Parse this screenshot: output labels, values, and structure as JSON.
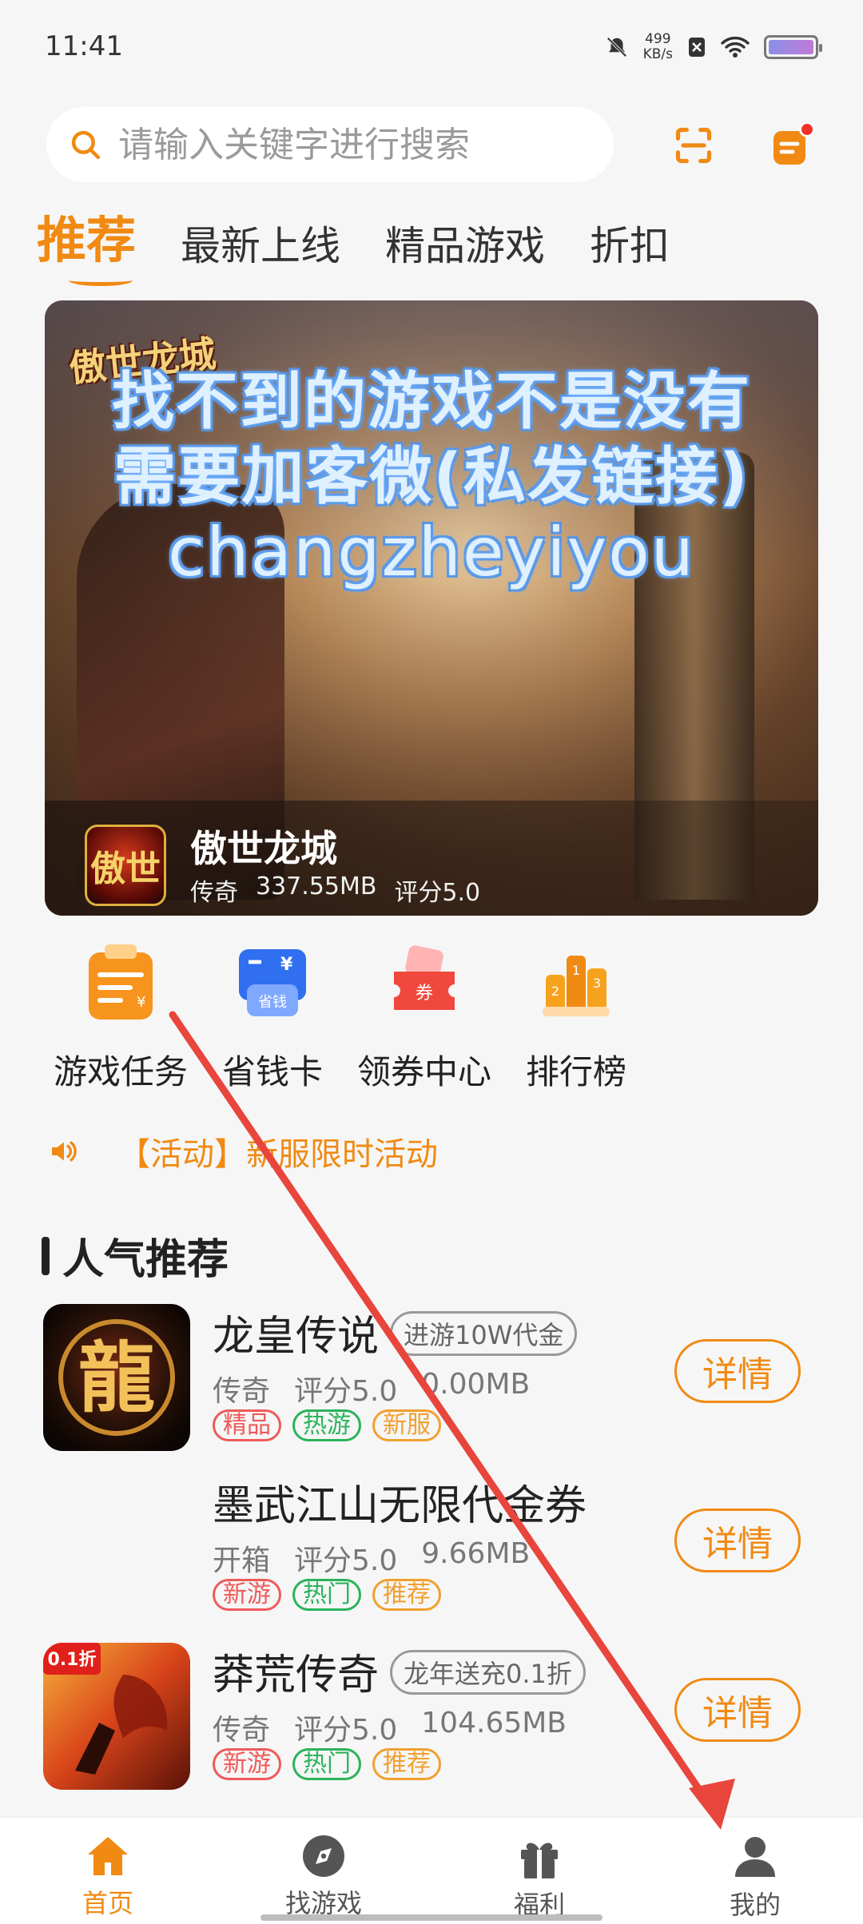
{
  "status_bar": {
    "time": "11:41",
    "net_speed_value": "499",
    "net_speed_unit": "KB/s"
  },
  "search": {
    "placeholder": "请输入关键字进行搜索"
  },
  "tabs": [
    {
      "label": "推荐",
      "active": true
    },
    {
      "label": "最新上线",
      "active": false
    },
    {
      "label": "精品游戏",
      "active": false
    },
    {
      "label": "折扣",
      "active": false
    }
  ],
  "banner": {
    "logo_text": "傲世龙城",
    "lines": [
      "找不到的游戏不是没有",
      "需要加客微(私发链接)",
      "changzheyiyou"
    ],
    "game_icon_text": "傲世",
    "game_name": "傲世龙城",
    "game_genre": "传奇",
    "game_size": "337.55MB",
    "game_rating": "评分5.0"
  },
  "quick_entries": [
    {
      "label": "游戏任务",
      "icon": "task-icon"
    },
    {
      "label": "省钱卡",
      "icon": "saving-card-icon",
      "icon_text": "省钱"
    },
    {
      "label": "领券中心",
      "icon": "coupon-icon",
      "icon_text": "券"
    },
    {
      "label": "排行榜",
      "icon": "ranking-icon"
    }
  ],
  "notice": {
    "text": "【活动】新服限时活动"
  },
  "section": {
    "title": "人气推荐"
  },
  "games": [
    {
      "name": "龙皇传说",
      "promo": "进游10W代金",
      "genre": "传奇",
      "rating": "评分5.0",
      "size": "0.00MB",
      "tags": [
        {
          "text": "精品",
          "color": "red"
        },
        {
          "text": "热游",
          "color": "green"
        },
        {
          "text": "新服",
          "color": "orange"
        }
      ],
      "icon_text": "龍",
      "button": "详情"
    },
    {
      "name": "墨武江山无限代金券",
      "promo": "",
      "genre": "开箱",
      "rating": "评分5.0",
      "size": "9.66MB",
      "tags": [
        {
          "text": "新游",
          "color": "red"
        },
        {
          "text": "热门",
          "color": "green"
        },
        {
          "text": "推荐",
          "color": "orange"
        }
      ],
      "icon_text": "",
      "button": "详情"
    },
    {
      "name": "莽荒传奇",
      "promo": "龙年送充0.1折",
      "genre": "传奇",
      "rating": "评分5.0",
      "size": "104.65MB",
      "tags": [
        {
          "text": "新游",
          "color": "red"
        },
        {
          "text": "热门",
          "color": "green"
        },
        {
          "text": "推荐",
          "color": "orange"
        }
      ],
      "icon_text": "0.1折",
      "button": "详情"
    }
  ],
  "bottom_nav": [
    {
      "label": "首页",
      "icon": "home-icon",
      "active": true
    },
    {
      "label": "找游戏",
      "icon": "compass-icon",
      "active": false
    },
    {
      "label": "福利",
      "icon": "gift-icon",
      "active": false
    },
    {
      "label": "我的",
      "icon": "user-icon",
      "active": false
    }
  ],
  "colors": {
    "accent": "#f08a13",
    "annotation_arrow": "#e8453c"
  }
}
